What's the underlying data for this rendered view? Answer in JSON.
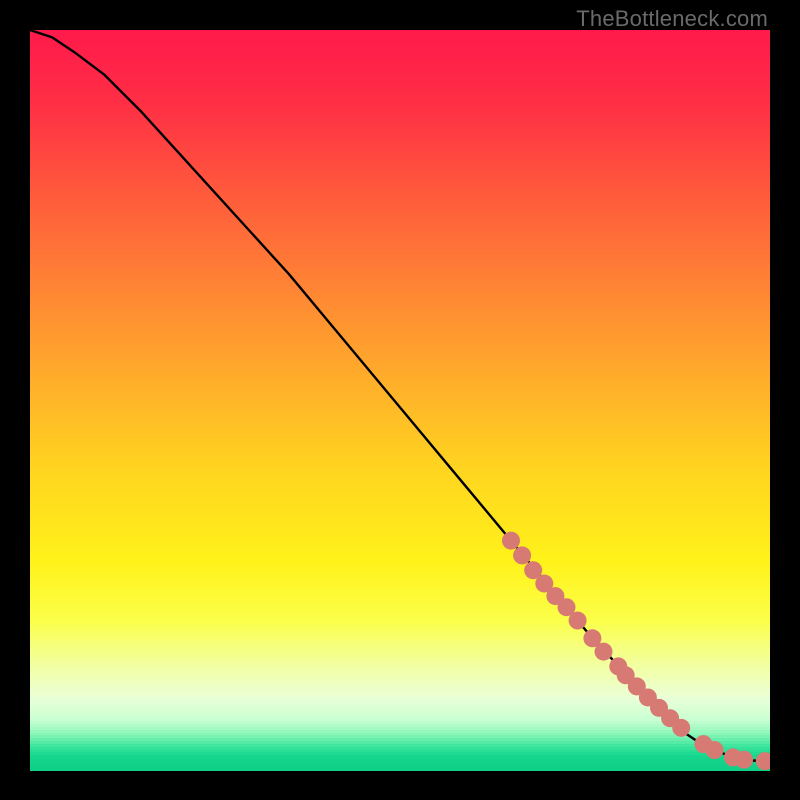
{
  "watermark": "TheBottleneck.com",
  "colors": {
    "frame_bg": "#000000",
    "curve": "#000000",
    "marker_fill": "#d87a74",
    "marker_stroke": "#b85b55"
  },
  "gradient_stops": [
    {
      "pct": 0.0,
      "color": "#ff1a4b"
    },
    {
      "pct": 0.1,
      "color": "#ff2f45"
    },
    {
      "pct": 0.22,
      "color": "#ff5a3c"
    },
    {
      "pct": 0.35,
      "color": "#ff8534"
    },
    {
      "pct": 0.48,
      "color": "#ffb02a"
    },
    {
      "pct": 0.6,
      "color": "#ffd61f"
    },
    {
      "pct": 0.72,
      "color": "#fff21a"
    },
    {
      "pct": 0.8,
      "color": "#fbff4a"
    },
    {
      "pct": 0.86,
      "color": "#f2ffa0"
    },
    {
      "pct": 0.905,
      "color": "#eaffd8"
    },
    {
      "pct": 0.935,
      "color": "#c8ffd2"
    },
    {
      "pct": 0.955,
      "color": "#86f5b5"
    },
    {
      "pct": 0.972,
      "color": "#34e39a"
    },
    {
      "pct": 0.985,
      "color": "#15d58c"
    },
    {
      "pct": 1.0,
      "color": "#10cf87"
    }
  ],
  "chart_data": {
    "type": "line",
    "title": "",
    "xlabel": "",
    "ylabel": "",
    "xlim": [
      0,
      100
    ],
    "ylim": [
      0,
      100
    ],
    "series": [
      {
        "name": "bottleneck-curve",
        "x": [
          0,
          3,
          6,
          10,
          15,
          20,
          25,
          30,
          35,
          40,
          45,
          50,
          55,
          60,
          65,
          70,
          75,
          80,
          84,
          87,
          90,
          93,
          95,
          97,
          100
        ],
        "y": [
          100,
          99,
          97,
          94,
          89,
          83.5,
          78,
          72.5,
          67,
          61,
          55,
          49,
          43,
          37,
          31,
          25,
          19,
          13.5,
          9,
          6,
          4,
          2.5,
          1.7,
          1.3,
          1.2
        ]
      }
    ],
    "markers": {
      "name": "highlighted-points",
      "x": [
        65,
        66.5,
        68,
        69.5,
        71,
        72.5,
        74,
        76,
        77.5,
        79.5,
        80.5,
        82,
        83.5,
        85,
        86.5,
        88,
        91,
        92.5,
        95,
        96.5,
        99.3
      ],
      "y": [
        31,
        29,
        27,
        25.2,
        23.5,
        22,
        20.2,
        17.8,
        16,
        14,
        12.8,
        11.3,
        9.8,
        8.4,
        7.0,
        5.7,
        3.5,
        2.7,
        1.7,
        1.4,
        1.2
      ]
    }
  }
}
